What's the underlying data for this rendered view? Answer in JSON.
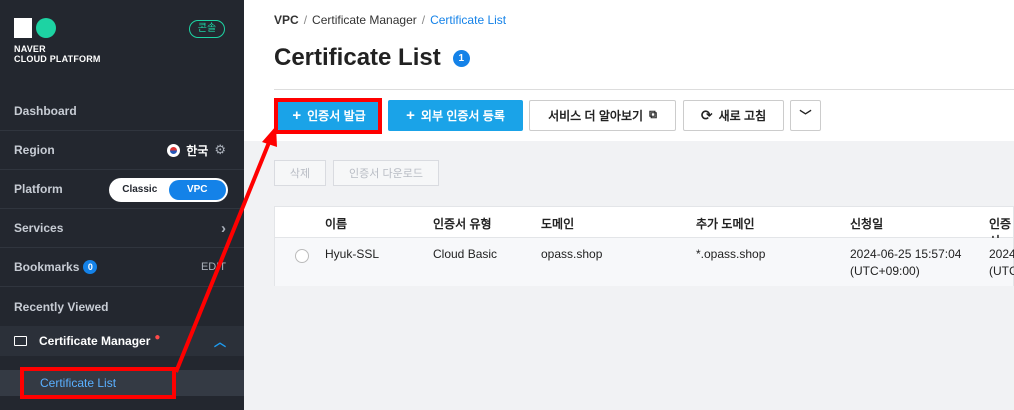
{
  "sidebar": {
    "logo_line1": "NAVER",
    "logo_line2": "CLOUD PLATFORM",
    "console_badge": "콘솔",
    "dashboard": "Dashboard",
    "region_label": "Region",
    "region_value": "한국",
    "platform_label": "Platform",
    "platform_classic": "Classic",
    "platform_vpc": "VPC",
    "services": "Services",
    "bookmarks": "Bookmarks",
    "bookmarks_count": "0",
    "edit": "EDIT",
    "recently_viewed": "Recently Viewed",
    "certificate_manager": "Certificate Manager",
    "certificate_list": "Certificate List"
  },
  "breadcrumb": {
    "a": "VPC",
    "b": "Certificate Manager",
    "c": "Certificate List",
    "sep": "/"
  },
  "page": {
    "title": "Certificate List",
    "info": "1"
  },
  "toolbar": {
    "issue": "인증서 발급",
    "external": "외부 인증서 등록",
    "learn_more": "서비스 더 알아보기",
    "refresh": "새로 고침"
  },
  "actions": {
    "delete": "삭제",
    "download": "인증서 다운로드"
  },
  "table": {
    "headers": [
      "이름",
      "인증서 유형",
      "도메인",
      "추가 도메인",
      "신청일",
      "인증 시"
    ],
    "row": {
      "name": "Hyuk-SSL",
      "type": "Cloud Basic",
      "domain": "opass.shop",
      "extra_domain": "*.opass.shop",
      "date": "2024-06-25 15:57:04",
      "tz": "(UTC+09:00)",
      "cert_date": "2024",
      "cert_tz": "(UTC"
    }
  }
}
